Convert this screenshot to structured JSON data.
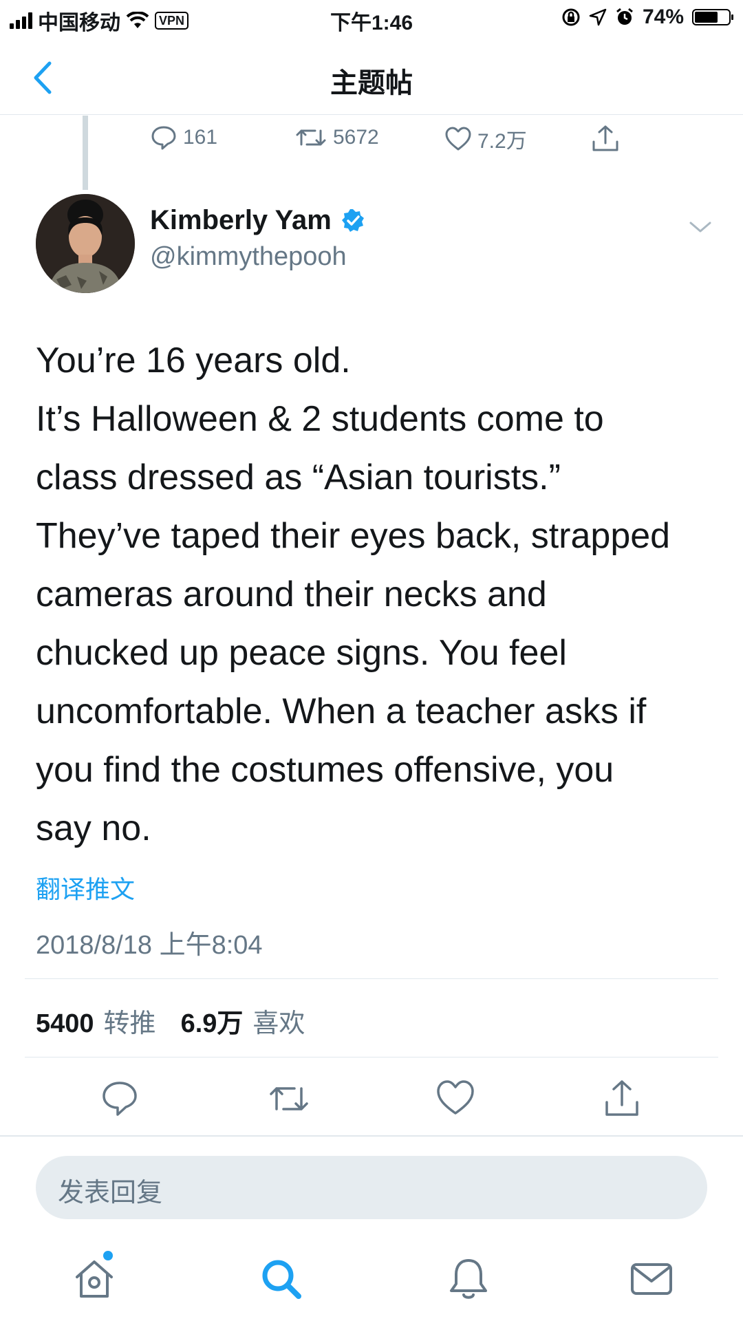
{
  "status_bar": {
    "carrier": "中国移动",
    "vpn": "VPN",
    "time": "下午1:46",
    "battery": "74%",
    "battery_level": 0.74
  },
  "nav": {
    "title": "主题帖",
    "back_icon": "chevron-left-icon"
  },
  "previous_tweet": {
    "replies": "161",
    "retweets": "5672",
    "likes": "7.2万"
  },
  "author": {
    "name": "Kimberly Yam",
    "handle": "@kimmythepooh",
    "verified": true
  },
  "tweet": {
    "lines": [
      "You’re 16 years old.",
      "It’s Halloween & 2 students come to",
      "class dressed as “Asian tourists.”",
      "They’ve taped their eyes back, strapped",
      "cameras around their necks and",
      "chucked up peace signs. You feel",
      "uncomfortable. When a teacher asks if",
      "you find the costumes offensive, you",
      "say no."
    ],
    "translate_label": "翻译推文",
    "timestamp": "2018/8/18 上午8:04"
  },
  "engagement": {
    "retweets_count": "5400",
    "retweets_label": "转推",
    "likes_count": "6.9万",
    "likes_label": "喜欢"
  },
  "reply": {
    "placeholder": "发表回复"
  },
  "tabbar": {
    "active": "search",
    "items": [
      "home-icon",
      "search-icon",
      "bell-icon",
      "mail-icon"
    ]
  },
  "colors": {
    "accent": "#1da1f2",
    "muted": "#657786",
    "text": "#14171a"
  }
}
